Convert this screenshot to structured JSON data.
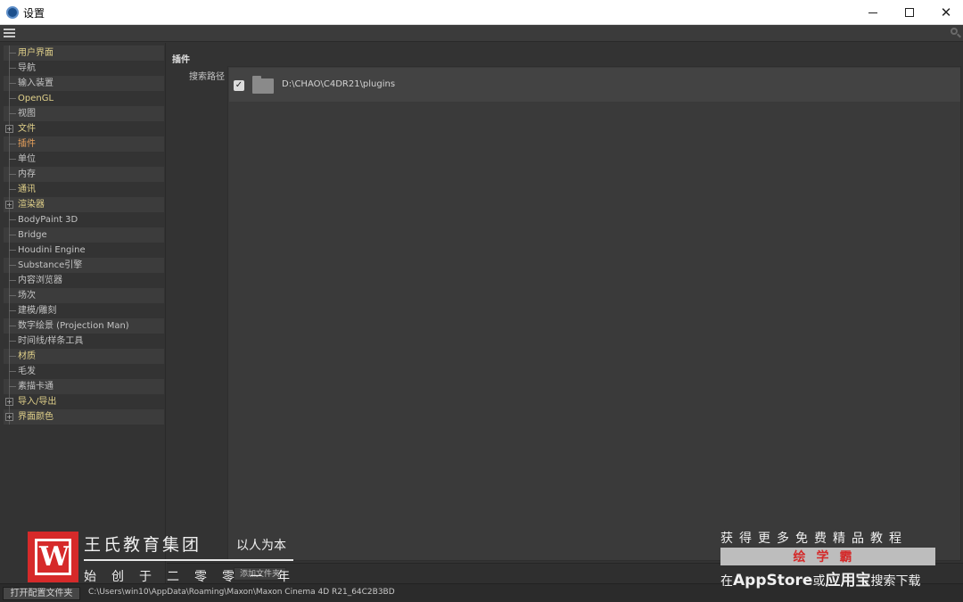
{
  "window": {
    "title": "设置",
    "app_icon": "cinema4d-logo-icon",
    "controls": {
      "minimize": "—",
      "maximize": "☐",
      "close": "✕"
    }
  },
  "toolbar": {
    "menu_icon": "hamburger-menu-icon",
    "search_icon": "search-icon"
  },
  "sidebar": {
    "items": [
      {
        "label": "用户界面",
        "style": "hl",
        "expander": false
      },
      {
        "label": "导航",
        "style": "normal",
        "expander": false
      },
      {
        "label": "输入装置",
        "style": "normal",
        "expander": false
      },
      {
        "label": "OpenGL",
        "style": "hl",
        "expander": false
      },
      {
        "label": "视图",
        "style": "normal",
        "expander": false
      },
      {
        "label": "文件",
        "style": "hl",
        "expander": true
      },
      {
        "label": "插件",
        "style": "active",
        "expander": false
      },
      {
        "label": "单位",
        "style": "normal",
        "expander": false
      },
      {
        "label": "内存",
        "style": "normal",
        "expander": false
      },
      {
        "label": "通讯",
        "style": "hl",
        "expander": false
      },
      {
        "label": "渲染器",
        "style": "hl",
        "expander": true
      },
      {
        "label": "BodyPaint 3D",
        "style": "normal",
        "expander": false
      },
      {
        "label": "Bridge",
        "style": "normal",
        "expander": false
      },
      {
        "label": "Houdini Engine",
        "style": "normal",
        "expander": false
      },
      {
        "label": "Substance引擎",
        "style": "normal",
        "expander": false
      },
      {
        "label": "内容浏览器",
        "style": "normal",
        "expander": false
      },
      {
        "label": "场次",
        "style": "normal",
        "expander": false
      },
      {
        "label": "建模/雕刻",
        "style": "normal",
        "expander": false
      },
      {
        "label": "数字绘景 (Projection Man)",
        "style": "normal",
        "expander": false
      },
      {
        "label": "时间线/样条工具",
        "style": "normal",
        "expander": false
      },
      {
        "label": "材质",
        "style": "hl",
        "expander": false
      },
      {
        "label": "毛发",
        "style": "normal",
        "expander": false
      },
      {
        "label": "素描卡通",
        "style": "normal",
        "expander": false
      },
      {
        "label": "导入/导出",
        "style": "hl",
        "expander": true
      },
      {
        "label": "界面颜色",
        "style": "hl",
        "expander": true
      }
    ]
  },
  "main": {
    "section_title": "插件",
    "search_path_label": "搜索路径",
    "paths": [
      {
        "checked": true,
        "icon": "folder-icon",
        "path": "D:\\CHAO\\C4DR21\\plugins"
      }
    ],
    "add_folder_label": "添加文件夹"
  },
  "statusbar": {
    "open_config_label": "打开配置文件夹",
    "config_path": "C:\\Users\\win10\\AppData\\Roaming\\Maxon\\Maxon Cinema 4D R21_64C2B3BD"
  },
  "watermark": {
    "logo_letter": "W",
    "company": "王氏教育集团",
    "slogan": "以人为本",
    "founded": "始创于二零零一年",
    "more_tutorials": "获得更多免费精品教程",
    "brand": "绘学霸",
    "download_prefix": "在",
    "download_store": "AppStore",
    "download_or": "或",
    "download_store2": "应用宝",
    "download_suffix": "搜索下载"
  },
  "colors": {
    "panel": "#333333",
    "highlight_text": "#e0d08a",
    "active_text": "#e8a15c",
    "brand_red": "#d62a2a"
  }
}
